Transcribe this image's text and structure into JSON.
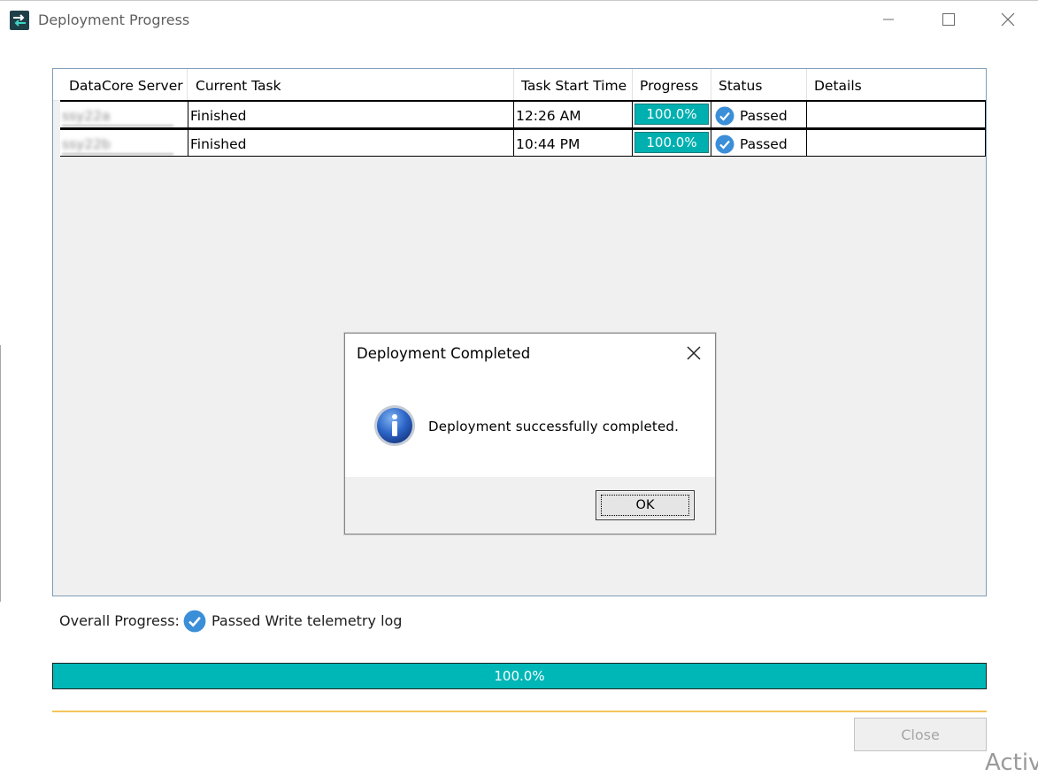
{
  "window": {
    "title": "Deployment Progress",
    "icon": "swap-arrows-icon",
    "controls": {
      "minimize": "minimize-icon",
      "maximize": "maximize-icon",
      "close": "close-icon"
    }
  },
  "grid": {
    "columns": [
      "DataCore Server",
      "Current Task",
      "Task Start Time",
      "Progress",
      "Status",
      "Details"
    ],
    "rows": [
      {
        "server": "ssy22a",
        "task": "Finished",
        "start_time": "12:26 AM",
        "progress": "100.0%",
        "progress_fraction": 1.0,
        "status": "Passed",
        "details": ""
      },
      {
        "server": "ssy22b",
        "task": "Finished",
        "start_time": "10:44 PM",
        "progress": "100.0%",
        "progress_fraction": 1.0,
        "status": "Passed",
        "details": ""
      }
    ]
  },
  "dialog": {
    "title": "Deployment Completed",
    "message": "Deployment successfully completed.",
    "ok_label": "OK",
    "icon": "info-icon"
  },
  "overall": {
    "label": "Overall Progress:",
    "status": "Passed Write telemetry log",
    "progress": "100.0%",
    "progress_fraction": 1.0
  },
  "footer": {
    "close_label": "Close"
  },
  "watermark": "Activ",
  "colors": {
    "progress_fill": "#00b7b7",
    "check_blue": "#3b8ed8",
    "separator": "#f2c45a"
  }
}
